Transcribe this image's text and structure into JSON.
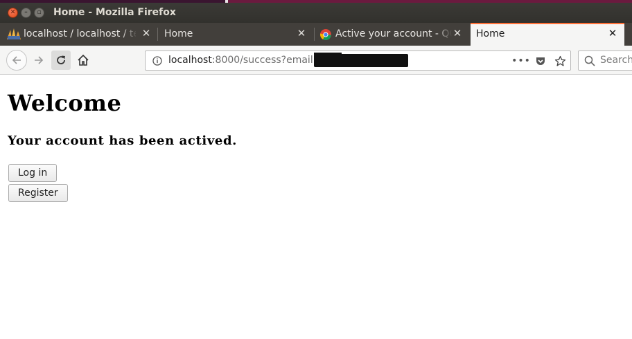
{
  "window": {
    "title": "Home - Mozilla Firefox"
  },
  "tabs": [
    {
      "label": "localhost / localhost / te",
      "active": false,
      "icon": "phpmyadmin-icon"
    },
    {
      "label": "Home",
      "active": false
    },
    {
      "label": "Active your account - QC",
      "active": false,
      "icon": "chrome-icon"
    },
    {
      "label": "Home",
      "active": true
    }
  ],
  "urlbar": {
    "host": "localhost",
    "path": ":8000/success?email="
  },
  "search": {
    "placeholder": "Search"
  },
  "page": {
    "heading": "Welcome",
    "message": "Your account has been actived.",
    "login_label": "Log in",
    "register_label": "Register"
  },
  "colors": {
    "accent": "#ff7139",
    "titlebar": "#3b3a36",
    "tabstrip": "#423f3b",
    "close_button": "#df4a16"
  }
}
